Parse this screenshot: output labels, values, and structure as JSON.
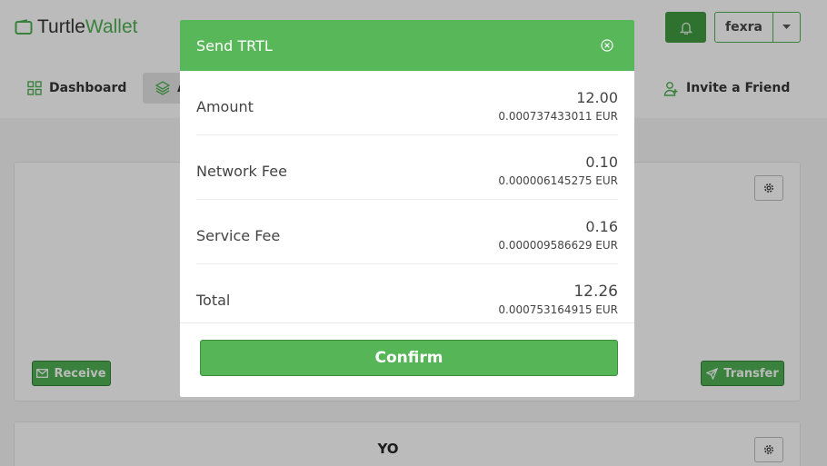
{
  "app": {
    "logo_part1": "Turtle",
    "logo_part2": "Wallet",
    "user_name": "fexra"
  },
  "nav": {
    "dashboard": "Dashboard",
    "active_partial": "A",
    "invite": "Invite a Friend"
  },
  "cards": {
    "receive_label": "Receive",
    "transfer_label": "Transfer",
    "second_title": "YO"
  },
  "modal": {
    "title": "Send TRTL",
    "rows": [
      {
        "label": "Amount",
        "value": "12.00",
        "sub": "0.000737433011 EUR"
      },
      {
        "label": "Network Fee",
        "value": "0.10",
        "sub": "0.000006145275 EUR"
      },
      {
        "label": "Service Fee",
        "value": "0.16",
        "sub": "0.000009586629 EUR"
      },
      {
        "label": "Total",
        "value": "12.26",
        "sub": "0.000753164915 EUR"
      }
    ],
    "confirm_label": "Confirm"
  },
  "icons": {
    "logo": "wallet-icon",
    "bell": "bell-icon",
    "caret": "chevron-down-icon",
    "dashboard": "grid-icon",
    "active": "layers-icon",
    "invite": "user-plus-icon",
    "gear": "gear-icon",
    "receive": "envelope-icon",
    "transfer": "send-icon",
    "close": "close-circle-icon"
  },
  "colors": {
    "brand_green": "#4caf50",
    "modal_header": "#58b758",
    "confirm_button": "#56b556"
  }
}
